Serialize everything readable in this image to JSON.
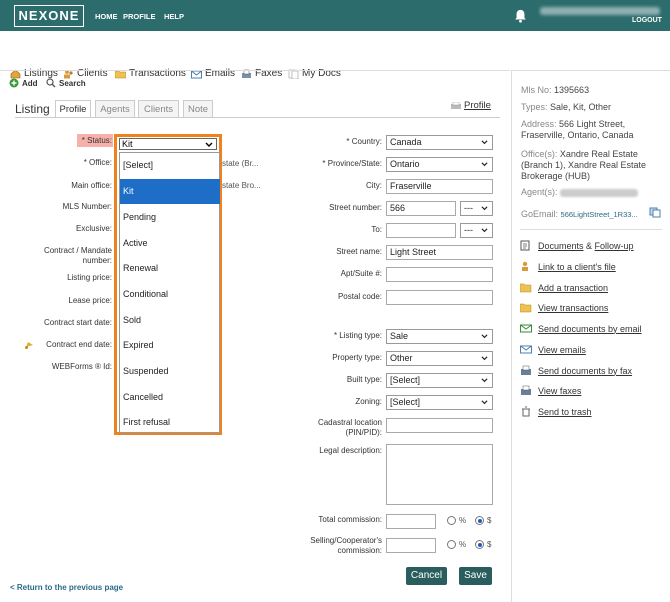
{
  "app": {
    "logo": "NEXONE",
    "nav": [
      "HOME",
      "PROFILE",
      "HELP"
    ],
    "logout": "LOGOUT"
  },
  "modules": [
    "Listings",
    "Clients",
    "Transactions",
    "Emails",
    "Faxes",
    "My Docs"
  ],
  "toolbar": {
    "add": "Add",
    "search": "Search"
  },
  "page": {
    "title": "Listing",
    "tabs": [
      "Profile",
      "Agents",
      "Clients",
      "Note"
    ],
    "profile_link": "Profile"
  },
  "form_left": {
    "status": "* Status:",
    "office": "* Office:",
    "main_office": "Main office:",
    "mls_number": "MLS Number:",
    "exclusive": "Exclusive:",
    "contract_mandate": "Contract / Mandate number:",
    "listing_price": "Listing price:",
    "lease_price": "Lease price:",
    "contract_start": "Contract start date:",
    "contract_end": "Contract end date:",
    "webforms": "WEBForms ® Id:",
    "office_value": "state (Br...",
    "main_office_value": "state Bro..."
  },
  "status_dropdown": {
    "selected": "Kit",
    "options": [
      "[Select]",
      "Kit",
      "Pending",
      "Active",
      "Renewal",
      "Conditional",
      "Sold",
      "Expired",
      "Suspended",
      "Cancelled",
      "First refusal"
    ],
    "highlighted": "Kit"
  },
  "form_right": {
    "country_label": "* Country:",
    "country": "Canada",
    "province_label": "* Province/State:",
    "province": "Ontario",
    "city_label": "City:",
    "city": "Fraserville",
    "street_number_label": "Street number:",
    "street_number": "566",
    "street_number_suffix": "---",
    "to_label": "To:",
    "to_suffix": "---",
    "street_name_label": "Street name:",
    "street_name": "Light Street",
    "apt_label": "Apt/Suite #:",
    "postal_label": "Postal code:",
    "listing_type_label": "* Listing type:",
    "listing_type": "Sale",
    "property_type_label": "Property type:",
    "property_type": "Other",
    "built_type_label": "Built type:",
    "built_type": "[Select]",
    "zoning_label": "Zoning:",
    "zoning": "[Select]",
    "cadastral_label": "Cadastral location (PIN/PID):",
    "legal_label": "Legal description:",
    "total_commission_label": "Total commission:",
    "selling_commission_label": "Selling/Cooperator's commission:",
    "pct": "%",
    "dollar": "$"
  },
  "buttons": {
    "cancel": "Cancel",
    "save": "Save"
  },
  "back_link": "< Return to the previous page",
  "sidebar_info": {
    "mls_label": "Mls No:",
    "mls": "1395663",
    "types_label": "Types:",
    "types": "Sale, Kit, Other",
    "address_label": "Address:",
    "address": "566 Light Street, Fraserville, Ontario, Canada",
    "offices_label": "Office(s):",
    "offices": "Xandre Real Estate (Branch 1), Xandre Real Estate Brokerage (HUB)",
    "agents_label": "Agent(s):",
    "goemail_label": "GoEmail:",
    "goemail": "566LightStreet_1R33..."
  },
  "sidebar_links": [
    {
      "text": "Documents",
      "extra": " & ",
      "text2": "Follow-up",
      "icon": "documents-icon"
    },
    {
      "text": "Link to a client's file",
      "icon": "client-link-icon"
    },
    {
      "text": "Add a transaction",
      "icon": "folder-icon"
    },
    {
      "text": "View transactions",
      "icon": "folder-icon"
    },
    {
      "text": "Send documents by email",
      "icon": "email-icon"
    },
    {
      "text": "View emails",
      "icon": "email-icon"
    },
    {
      "text": "Send documents by fax",
      "icon": "fax-icon"
    },
    {
      "text": "View faxes",
      "icon": "fax-icon"
    },
    {
      "text": "Send to trash",
      "icon": "trash-icon"
    }
  ],
  "colors": {
    "header": "#2d6c6c",
    "highlight": "#1e6ec8",
    "callout": "#f0821e",
    "status_label_bg": "#f6b1aa",
    "button": "#2a5e5e"
  }
}
